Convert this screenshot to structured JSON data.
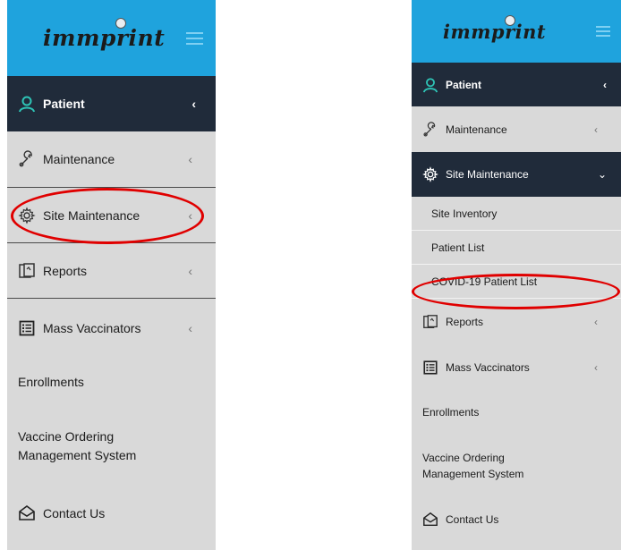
{
  "brand": {
    "logo_text": "immprint"
  },
  "left_menu": {
    "patient": "Patient",
    "maintenance": "Maintenance",
    "site_maintenance": "Site Maintenance",
    "reports": "Reports",
    "mass_vaccinators": "Mass Vaccinators",
    "enrollments": "Enrollments",
    "vaccine_ordering": "Vaccine Ordering Management System",
    "contact_us": "Contact Us"
  },
  "right_menu": {
    "patient": "Patient",
    "maintenance": "Maintenance",
    "site_maintenance": "Site Maintenance",
    "site_inventory": "Site Inventory",
    "patient_list": "Patient List",
    "covid_patient_list": "COVID-19 Patient List",
    "reports": "Reports",
    "mass_vaccinators": "Mass Vaccinators",
    "enrollments": "Enrollments",
    "vaccine_ordering": "Vaccine Ordering Management System",
    "contact_us": "Contact Us"
  },
  "glyphs": {
    "chevron_left": "‹",
    "chevron_down": "⌄"
  },
  "colors": {
    "header": "#1fa3dd",
    "active_bg": "#202b3a",
    "menu_bg": "#d9d9d9",
    "highlight": "#e00000",
    "person_icon": "#2ec4b6"
  }
}
